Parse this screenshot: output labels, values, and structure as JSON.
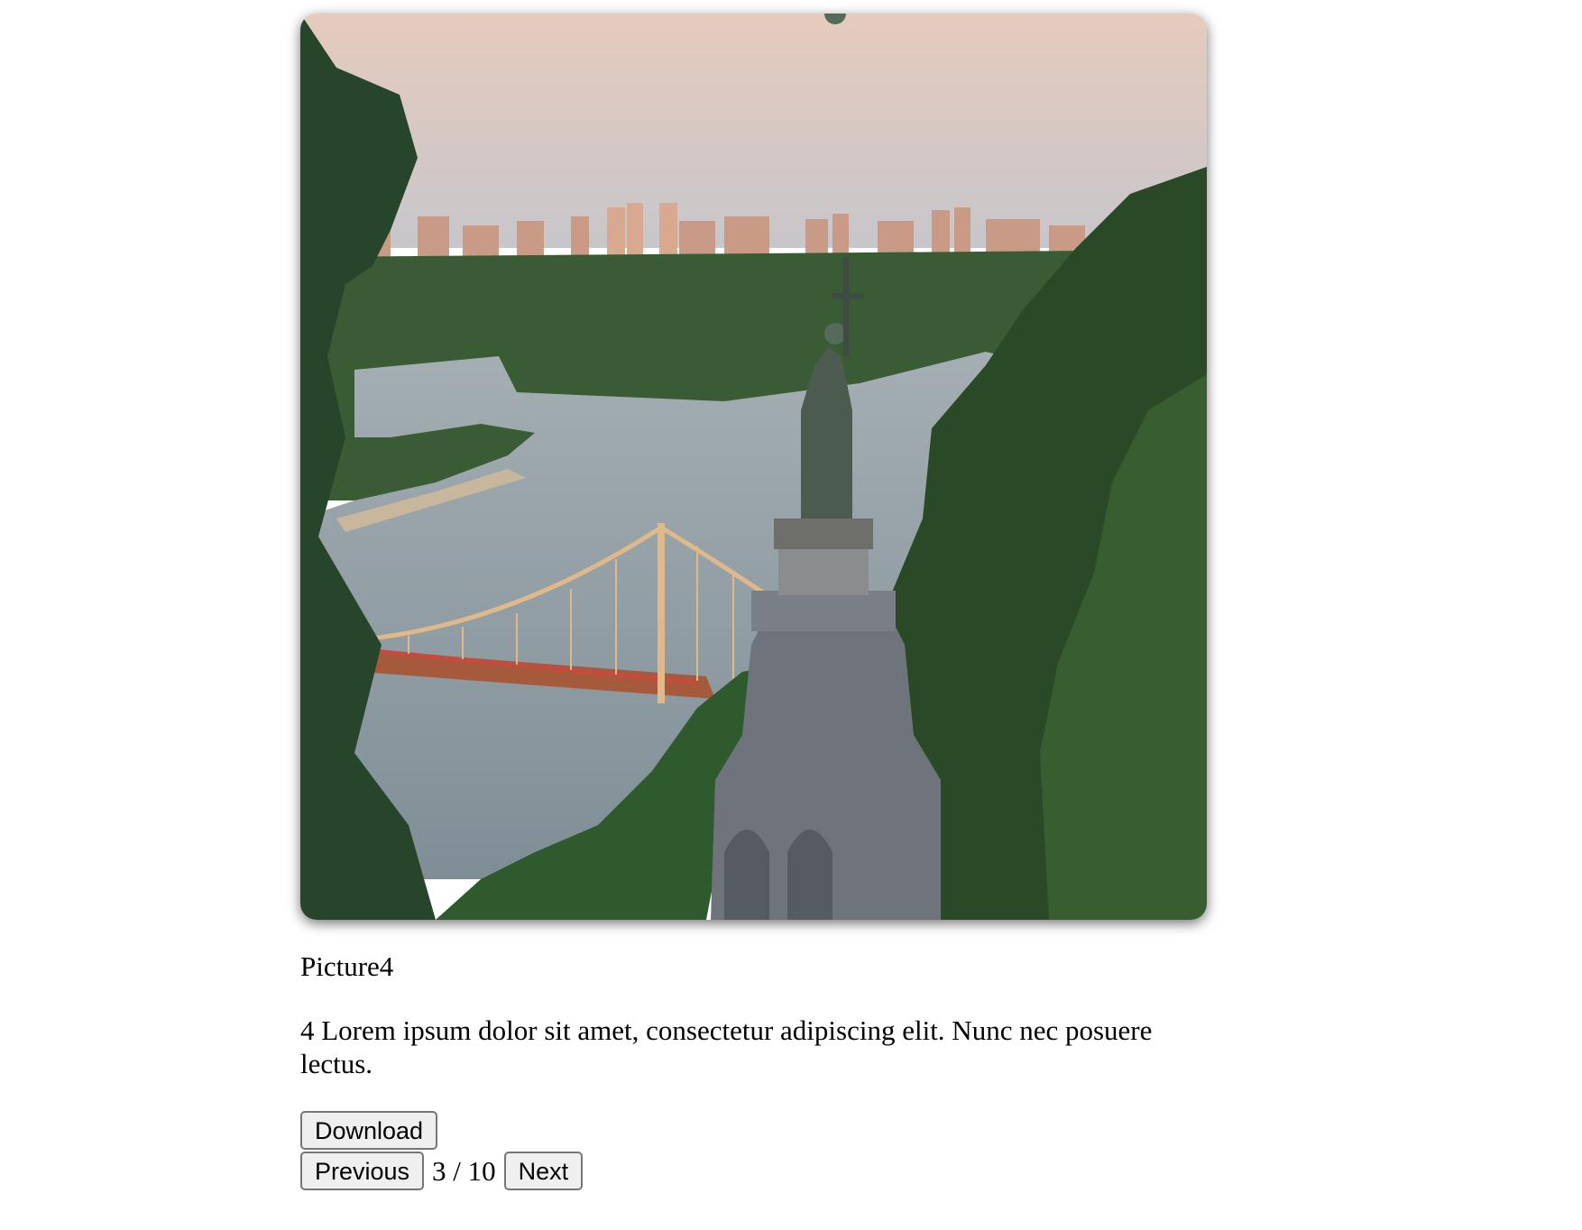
{
  "gallery": {
    "image": {
      "alt_icon": "photo-kyiv-river-monument",
      "colors": {
        "sky_top": "#e6cbbd",
        "sky_bottom": "#c9c3c6",
        "water": "#8a9ba3",
        "forest": "#2f4f2c",
        "bridge": "#e0b98a",
        "monument": "#6f747c"
      }
    },
    "title": "Picture4",
    "description": "4 Lorem ipsum dolor sit amet, consectetur adipiscing elit. Nunc nec posuere lectus.",
    "download_label": "Download",
    "previous_label": "Previous",
    "next_label": "Next",
    "page": {
      "current": 3,
      "total": 10,
      "text": "3 / 10"
    }
  }
}
